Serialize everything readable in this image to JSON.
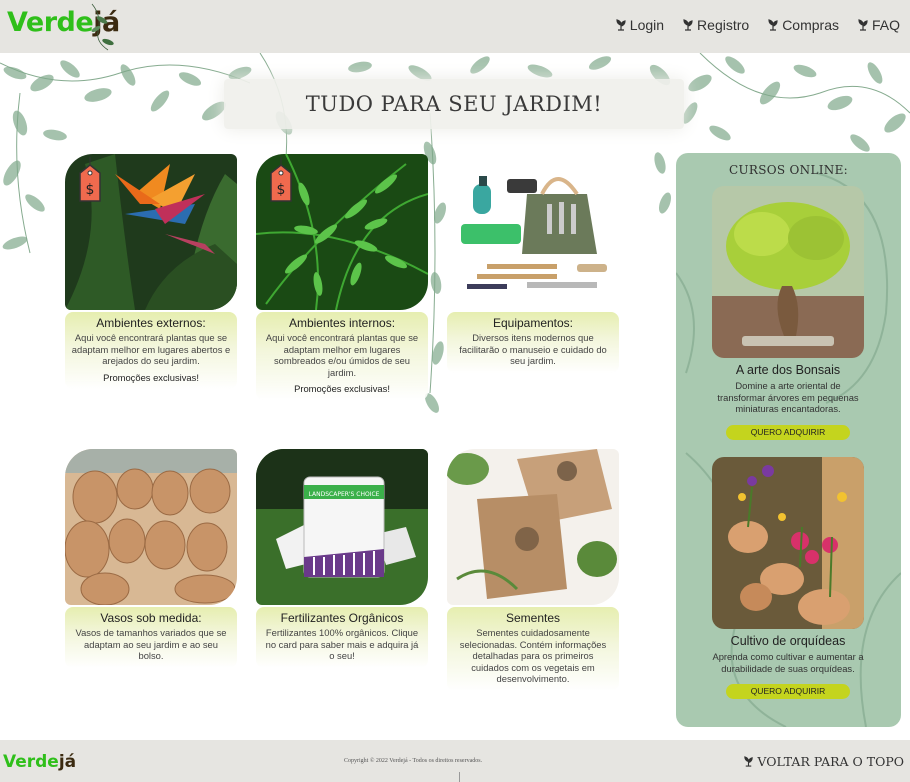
{
  "header": {
    "logo_primary": "Verde",
    "logo_secondary": "já",
    "nav": [
      {
        "label": "Login",
        "icon": "leaf-icon"
      },
      {
        "label": "Registro",
        "icon": "leaf-icon"
      },
      {
        "label": "Compras",
        "icon": "leaf-icon"
      },
      {
        "label": "FAQ",
        "icon": "leaf-icon"
      }
    ]
  },
  "banner": {
    "title": "TUDO PARA SEU JARDIM!"
  },
  "products": [
    {
      "title": "Ambientes externos:",
      "desc": "Aqui você encontrará plantas que se adaptam melhor em lugares abertos e arejados do seu jardim.",
      "promo": "Promoções exclusivas!",
      "price_tag": "$"
    },
    {
      "title": "Ambientes internos:",
      "desc": "Aqui você encontrará plantas que se adaptam melhor em lugares sombreados e/ou úmidos de seu jardim.",
      "promo": "Promoções exclusivas!",
      "price_tag": "$"
    },
    {
      "title": "Equipamentos:",
      "desc": "Diversos itens modernos que facilitarão o manuseio e cuidado do seu jardim."
    },
    {
      "title": "Vasos sob medida:",
      "desc": "Vasos de tamanhos variados que se adaptam ao seu jardim e ao seu bolso."
    },
    {
      "title": "Fertilizantes Orgânicos",
      "desc": "Fertilizantes 100% orgânicos. Clique no card para saber mais e adquira já o seu!",
      "bag_label": "LANDSCAPER'S CHOICE"
    },
    {
      "title": "Sementes",
      "desc": "Sementes cuidadosamente selecionadas. Contém informações detalhadas para os primeiros cuidados com os vegetais em desenvolvimento."
    }
  ],
  "courses": {
    "title": "CURSOS ONLINE:",
    "items": [
      {
        "title": "A arte dos Bonsais",
        "desc": "Domine a arte oriental de transformar árvores em pequenas miniaturas encantadoras.",
        "button": "QUERO ADQUIRIR"
      },
      {
        "title": "Cultivo de orquídeas",
        "desc": "Aprenda como cultivar e aumentar a durabilidade de suas orquídeas.",
        "button": "QUERO ADQUIRIR"
      }
    ]
  },
  "footer": {
    "logo_primary": "Verde",
    "logo_secondary": "já",
    "copyright": "Copyright © 2022 Verdejá - Todos os direitos reservados.",
    "to_top": "VOLTAR PARA O TOPO"
  },
  "colors": {
    "brand_green": "#2fbf1a",
    "brand_brown": "#3b2a10",
    "header_bg": "#e6e5e1",
    "side_bg": "#a9c9b0",
    "button": "#c4d41e",
    "card_body": "#e6eeb0"
  }
}
